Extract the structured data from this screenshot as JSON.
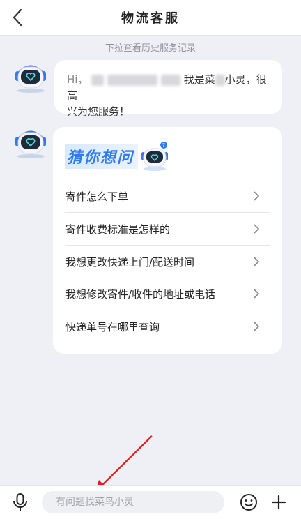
{
  "header": {
    "title": "物流客服"
  },
  "history_hint": "下拉查看历史服务记录",
  "greeting": {
    "lead": "Hi，",
    "middle": "我是菜",
    "end_line1": "小灵，很高",
    "line2": "兴为您服务！"
  },
  "guess_card": {
    "title": "猜你想问",
    "items": [
      {
        "label": "寄件怎么下单"
      },
      {
        "label": "寄件收费标准是怎样的"
      },
      {
        "label": "我想更改快递上门/配送时间"
      },
      {
        "label": "我想修改寄件/收件的地址或电话"
      },
      {
        "label": "快递单号在哪里查询"
      }
    ]
  },
  "input_bar": {
    "placeholder": "有问题找菜鸟小灵"
  },
  "colors": {
    "accent": "#2d7bf0",
    "annotation": "#e02020"
  }
}
